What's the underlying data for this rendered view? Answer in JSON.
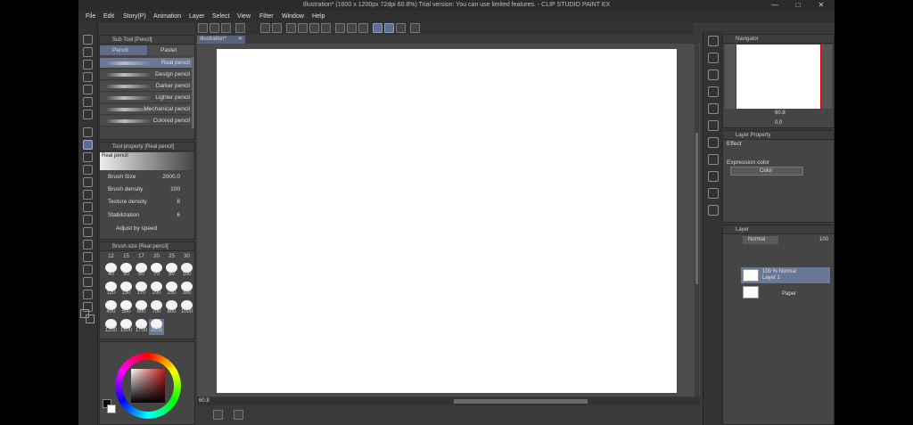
{
  "window": {
    "title": "Illustration* (1600 x 1200px 72dpi 60.8%)  Trial version: You can use limited features. - CLIP STUDIO PAINT EX",
    "minimize": "—",
    "maximize": "□",
    "close": "✕"
  },
  "menu": [
    "File",
    "Edit",
    "Story(P)",
    "Animation",
    "Layer",
    "Select",
    "View",
    "Filter",
    "Window",
    "Help"
  ],
  "canvas_tab": {
    "label": "Illustration*",
    "close": "✕"
  },
  "sub_tool": {
    "header": "Sub Tool [Pencil]",
    "tabs": [
      "Pencil",
      "Pastel"
    ],
    "active_tab": "Pencil",
    "brushes": [
      "Real pencil",
      "Design pencil",
      "Darker pencil",
      "Lighter pencil",
      "Mechanical pencil",
      "Colored pencil"
    ],
    "selected": "Real pencil"
  },
  "tool_property": {
    "header": "Tool property [Real pencil]",
    "preview_label": "Real pencil",
    "rows": [
      {
        "label": "Brush Size",
        "value": "2000.0"
      },
      {
        "label": "Brush density",
        "value": "100"
      },
      {
        "label": "Texture density",
        "value": "8"
      },
      {
        "label": "Stabilization",
        "value": "6"
      }
    ],
    "adjust_label": "Adjust by speed"
  },
  "brush_size": {
    "header": "Brush size [Real pencil]",
    "top_row": [
      "12",
      "15",
      "17",
      "20",
      "25",
      "30"
    ],
    "values": [
      "40",
      "50",
      "60",
      "70",
      "80",
      "100",
      "120",
      "150",
      "170",
      "200",
      "250",
      "300",
      "400",
      "500",
      "600",
      "700",
      "800",
      "1000",
      "1200",
      "1500",
      "1700",
      "2000"
    ],
    "selected": "2000"
  },
  "color": {
    "main": "#0b0b0b",
    "sub": "#ffffff",
    "sv_hue": "#c01818"
  },
  "navigator": {
    "header": "Navigator",
    "zoom": "60.8",
    "angle": "0.0"
  },
  "layer_property": {
    "header": "Layer Property",
    "effect_label": "Effect",
    "expression_color_label": "Expression color",
    "expression_color_value": "Color"
  },
  "layer": {
    "header": "Layer",
    "blend_mode": "Normal",
    "opacity": "100",
    "layers": [
      {
        "line1": "100 % Normal",
        "line2": "Layer 1",
        "selected": true
      },
      {
        "line1": "Paper",
        "line2": "",
        "selected": false
      }
    ]
  },
  "status": {
    "zoom": "60.8"
  }
}
